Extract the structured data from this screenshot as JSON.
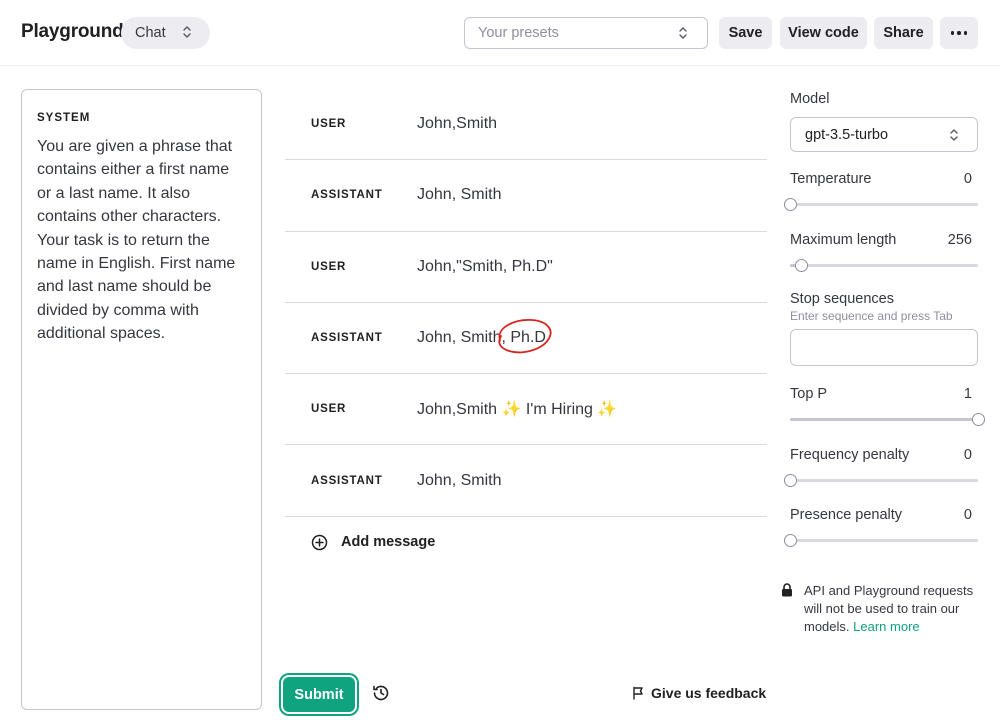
{
  "header": {
    "title": "Playground",
    "mode": "Chat",
    "presets_placeholder": "Your presets",
    "buttons": {
      "save": "Save",
      "view_code": "View code",
      "share": "Share"
    }
  },
  "system": {
    "label": "SYSTEM",
    "text": "You are given a phrase that contains either a first name or a last name. It also contains other characters. Your task is to return the name in English. First name and last name should be divided by comma with additional spaces."
  },
  "messages": [
    {
      "role": "USER",
      "content": "John,Smith"
    },
    {
      "role": "ASSISTANT",
      "content": "John, Smith"
    },
    {
      "role": "USER",
      "content": "John,\"Smith, Ph.D\""
    },
    {
      "role": "ASSISTANT",
      "content": "John, Smith, Ph.D"
    },
    {
      "role": "USER",
      "content": "John,Smith ✨ I'm Hiring ✨"
    },
    {
      "role": "ASSISTANT",
      "content": "John, Smith"
    }
  ],
  "add_message_label": "Add message",
  "submit_label": "Submit",
  "feedback_label": "Give us feedback",
  "settings": {
    "model_label": "Model",
    "model_value": "gpt-3.5-turbo",
    "temperature": {
      "label": "Temperature",
      "value": "0",
      "fraction": 0
    },
    "max_length": {
      "label": "Maximum length",
      "value": "256",
      "fraction": 0.06
    },
    "stop_sequences": {
      "label": "Stop sequences",
      "hint": "Enter sequence and press Tab"
    },
    "top_p": {
      "label": "Top P",
      "value": "1",
      "fraction": 1
    },
    "frequency_penalty": {
      "label": "Frequency penalty",
      "value": "0",
      "fraction": 0
    },
    "presence_penalty": {
      "label": "Presence penalty",
      "value": "0",
      "fraction": 0
    }
  },
  "privacy": {
    "text": "API and Playground requests will not be used to train our models.",
    "link": "Learn more"
  },
  "colors": {
    "accent": "#10a37f",
    "annotation": "#d9231f"
  }
}
